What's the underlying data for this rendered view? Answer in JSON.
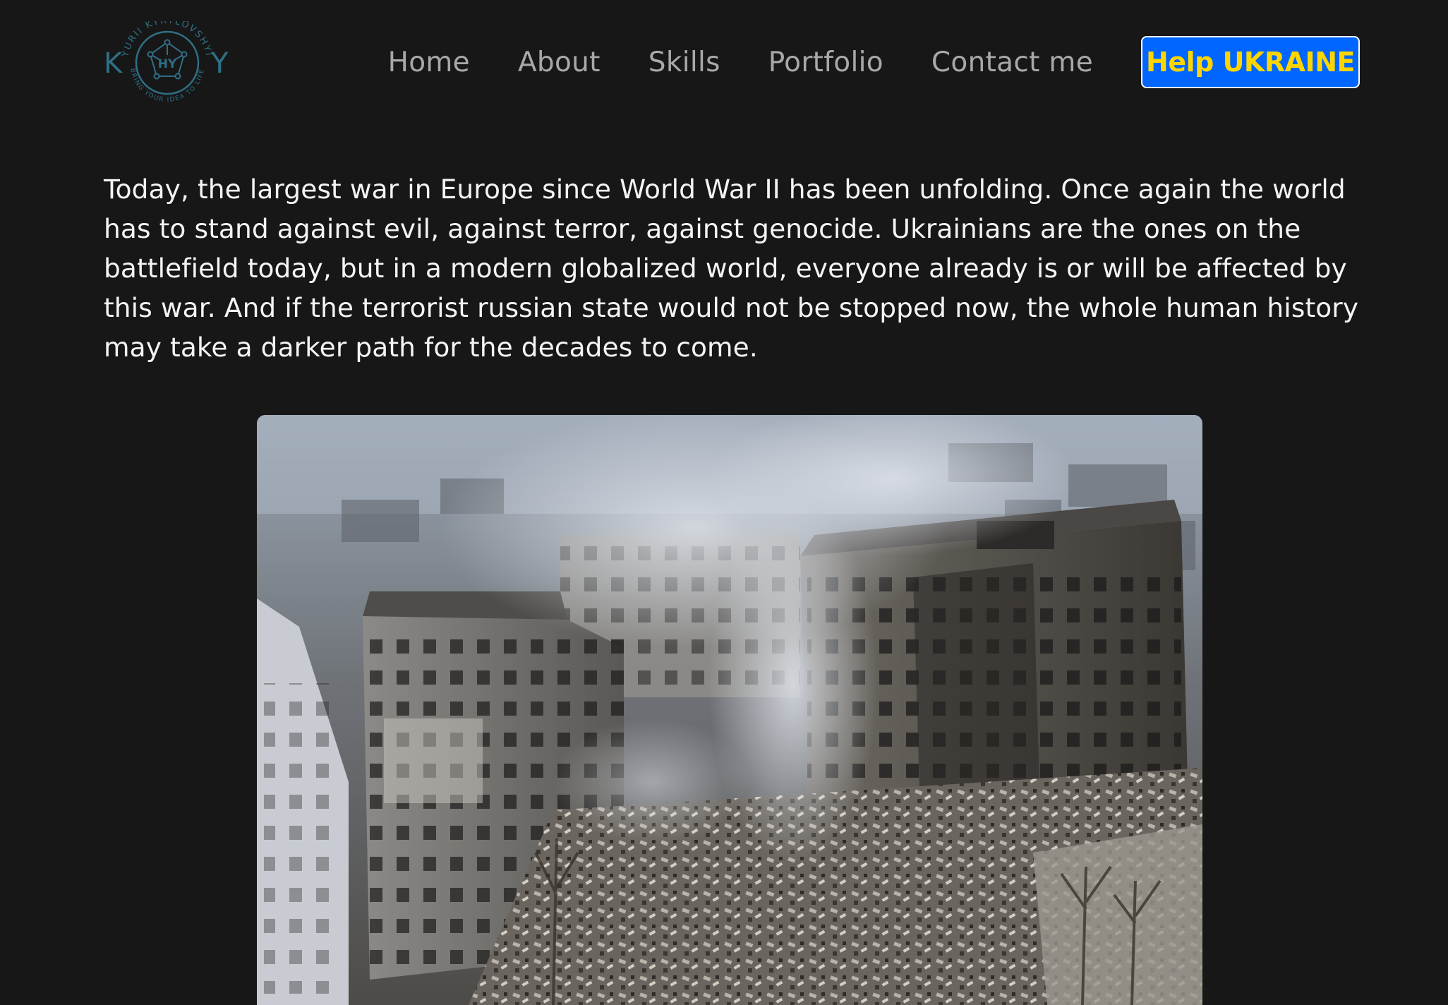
{
  "logo": {
    "letter_left": "K",
    "letter_right": "Y",
    "monogram": "HY",
    "ring_text_top": "YURII KYRYLOVSHYI",
    "ring_text_bottom": "BRING YOUR IDEA TO LIFE"
  },
  "nav": {
    "items": [
      {
        "label": "Home"
      },
      {
        "label": "About"
      },
      {
        "label": "Skills"
      },
      {
        "label": "Portfolio"
      },
      {
        "label": "Contact me"
      }
    ],
    "help_button": "Help UKRAINE"
  },
  "intro": {
    "text": "Today, the largest war in Europe since World War II has been unfolding. Once again the world has to stand against evil, against terror, against genocide. Ukrainians are the ones on the battlefield today, but in a modern globalized world, everyone already is or will be affected by this war. And if the terrorist russian state would not be stopped now, the whole human history may take a darker path for the decades to come."
  },
  "colors": {
    "background": "#171717",
    "nav_text": "#a8a8a8",
    "body_text": "#f4f4f4",
    "button_bg": "#0066ff",
    "button_text": "#ffd500",
    "logo_color": "#2f6f86"
  }
}
